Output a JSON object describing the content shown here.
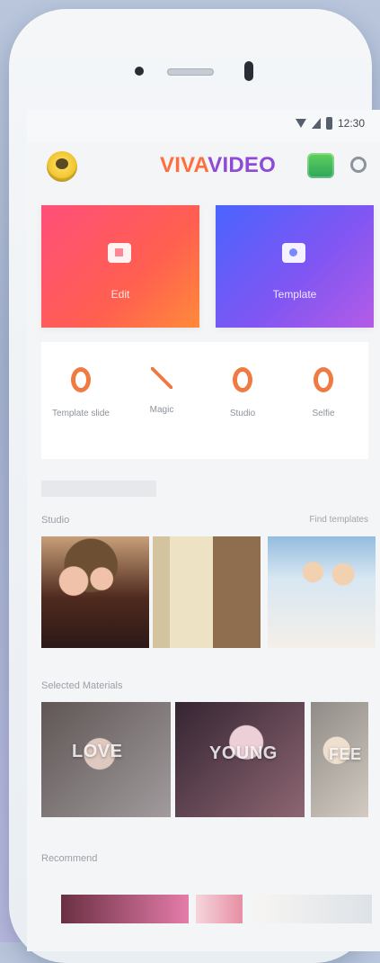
{
  "status_bar": {
    "time": "12:30"
  },
  "header": {
    "logo_a": "VIVA",
    "logo_b": "VIDEO"
  },
  "tiles": {
    "edit_label": "Edit",
    "template_label": "Template"
  },
  "quick_actions": [
    {
      "label": "Template slide"
    },
    {
      "label": "Magic"
    },
    {
      "label": "Studio"
    },
    {
      "label": "Selfie"
    }
  ],
  "sections": {
    "studio": {
      "title": "Studio",
      "link": "Find templates"
    },
    "featured": {
      "title": "Selected Materials"
    },
    "recommend": {
      "title": "Recommend"
    }
  },
  "overlays": {
    "love": "LOVE",
    "young": "YOUNG",
    "third": "FEE"
  }
}
